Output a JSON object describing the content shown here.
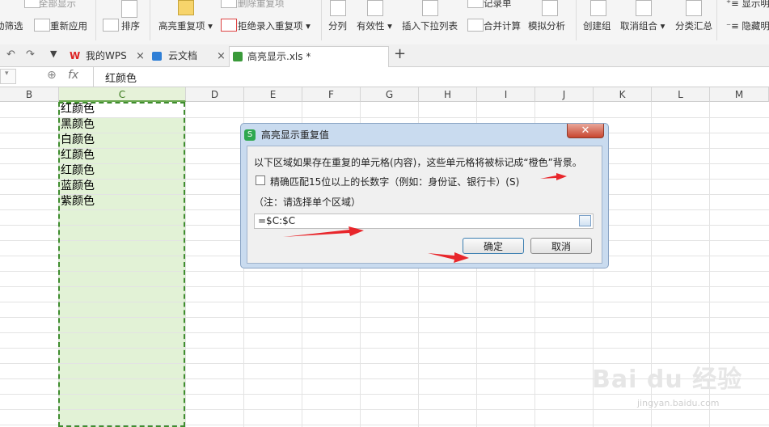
{
  "ribbon": {
    "items": [
      "全部显示",
      "重新应用",
      "动筛选",
      "排序",
      "高亮重复项",
      "删除重复项",
      "拒绝录入重复项",
      "分列",
      "有效性",
      "插入下拉列表",
      "记录单",
      "合并计算",
      "模拟分析",
      "创建组",
      "取消组合",
      "分类汇总",
      "显示明细",
      "隐藏明细"
    ]
  },
  "tabs": [
    {
      "label": "我的WPS",
      "icon": "wps-logo-icon"
    },
    {
      "label": "云文档",
      "icon": "cloud-doc-icon"
    },
    {
      "label": "高亮显示.xls *",
      "icon": "spreadsheet-file-icon"
    }
  ],
  "formula": {
    "fx": "fx",
    "value": "红颜色"
  },
  "columns": [
    "B",
    "C",
    "D",
    "E",
    "F",
    "G",
    "H",
    "I",
    "J",
    "K",
    "L",
    "M"
  ],
  "cells": [
    "红颜色",
    "黑颜色",
    "白颜色",
    "红颜色",
    "红颜色",
    "蓝颜色",
    "紫颜色"
  ],
  "dialog": {
    "title": "高亮显示重复值",
    "description": "以下区域如果存在重复的单元格(内容)，这些单元格将被标记成“橙色”背景。",
    "checkbox_label": "精确匹配15位以上的长数字（例如：身份证、银行卡）(S)",
    "note": "（注：请选择单个区域）",
    "range_value": "=$C:$C",
    "ok_label": "确定",
    "cancel_label": "取消"
  },
  "watermark": {
    "brand": "Bai du 经验",
    "url": "jingyan.baidu.com"
  },
  "colors": {
    "selection_fill": "#e2f2d6",
    "selection_border": "#3f8d2f",
    "arrow_red": "#e8262b"
  }
}
